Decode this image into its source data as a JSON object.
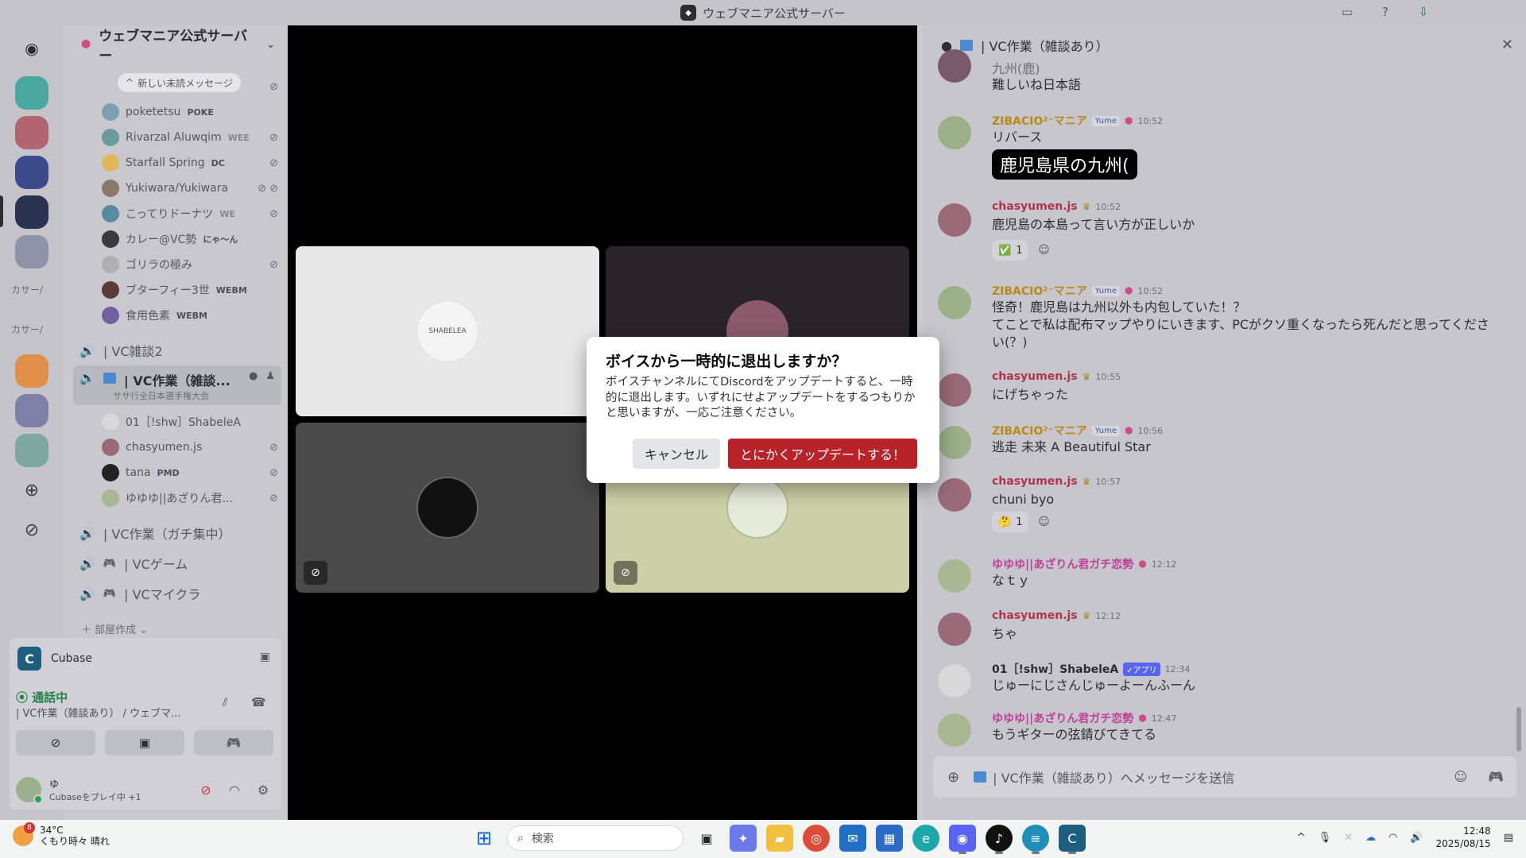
{
  "window": {
    "title": "ウェブマニア公式サーバー"
  },
  "rail": {
    "texts": [
      "カサー/",
      "カサー/"
    ]
  },
  "server": {
    "name": "ウェブマニア公式サーバー",
    "new_unread": "新しい未読メッセージ"
  },
  "members_top": [
    {
      "name": "poketetsu",
      "tag": "POKE"
    },
    {
      "name": "Rivarzal Aluwqim",
      "tag": "WEE"
    },
    {
      "name": "Starfall Spring",
      "tag": "DC"
    },
    {
      "name": "Yukiwara/Yukiwara",
      "tag": ""
    },
    {
      "name": "こってりドーナツ",
      "tag": "WE"
    },
    {
      "name": "カレー@VC勢",
      "tag": "にゃ〜ん"
    },
    {
      "name": "ゴリラの極み",
      "tag": ""
    },
    {
      "name": "ブターフィー3世",
      "tag": "WEBM"
    },
    {
      "name": "食用色素",
      "tag": "WEBM"
    }
  ],
  "channels": {
    "vc2": "| VC雑談2",
    "active": {
      "name": "| VC作業（雑談...",
      "sub": "ササ行全日本選手権大会"
    },
    "focus": "| VC作業（ガチ集中）",
    "game": "| VCゲーム",
    "mc": "| VCマイクラ"
  },
  "members_vc": [
    {
      "name": "01［!shw］ShabeleA"
    },
    {
      "name": "chasyumen.js"
    },
    {
      "name": "tana",
      "tag": "PMD"
    },
    {
      "name": "ゆゆゆ||あざりん君..."
    }
  ],
  "add_room": "部屋作成",
  "activity": {
    "game": "Cubase",
    "status": "通話中",
    "channel": "| VC作業（雑談あり） / ウェブマ...",
    "user": "ゆ",
    "user_status": "Cubaseをプレイ中 +1"
  },
  "stage": {
    "tile1_label": "SHABELEA"
  },
  "chat": {
    "header": "| VC作業（雑談あり）",
    "composer_placeholder": "| VC作業（雑談あり）へメッセージを送信",
    "messages": [
      {
        "text1": "九州(鹿)",
        "text2": "難しいね日本語"
      },
      {
        "name": "ZIBACIO²⁻マニア",
        "tag": "Yume",
        "time": "10:52",
        "text": "リバース",
        "image_text": "鹿児島県の九州("
      },
      {
        "name": "chasyumen.js",
        "time": "10:52",
        "text": "鹿児島の本島って言い方が正しいか",
        "reaction": "✅",
        "count": "1"
      },
      {
        "name": "ZIBACIO²⁻マニア",
        "tag": "Yume",
        "time": "10:52",
        "text": "怪奇！鹿児島は九州以外も内包していた！？",
        "text2": "てことで私は配布マップやりにいきます、PCがクソ重くなったら死んだと思ってくださ",
        "text3": "い(？)"
      },
      {
        "name": "chasyumen.js",
        "time": "10:55",
        "text": "にげちゃった"
      },
      {
        "name": "ZIBACIO²⁻マニア",
        "tag": "Yume",
        "time": "10:56",
        "text": "逃走 未来 A Beautiful Star"
      },
      {
        "name": "chasyumen.js",
        "time": "10:57",
        "text": "chuni byo",
        "reaction": "🤔",
        "count": "1"
      },
      {
        "name": "ゆゆゆ||あざりん君ガチ恋勢",
        "time": "12:12",
        "text": "なｔｙ"
      },
      {
        "name": "chasyumen.js",
        "time": "12:12",
        "text": "ちゃ"
      },
      {
        "name": "01［!shw］ShabeleA",
        "tag": "✓アプリ",
        "time": "12:34",
        "text": "じゅーにじさんじゅーよーんふーん"
      },
      {
        "name": "ゆゆゆ||あざりん君ガチ恋勢",
        "time": "12:47",
        "text": "もうギターの弦錆びてきてる"
      }
    ]
  },
  "modal": {
    "title": "ボイスから一時的に退出しますか？",
    "body": "ボイスチャンネルにてDiscordをアップデートすると、一時的に退出します。いずれにせよアップデートをするつもりかと思いますが、一応ご注意ください。",
    "cancel": "キャンセル",
    "confirm": "とにかくアップデートする！"
  },
  "taskbar": {
    "temp": "34°C",
    "weather": "くもり時々 晴れ",
    "badge": "8",
    "search": "検索",
    "time": "12:48",
    "date": "2025/08/15"
  },
  "colors": {
    "accent_danger": "#b8232a",
    "name_zibacio": "#b88a18",
    "name_chasyumen": "#b0344b",
    "name_yuyuyu": "#c03f9a",
    "voice_green": "#248046"
  }
}
